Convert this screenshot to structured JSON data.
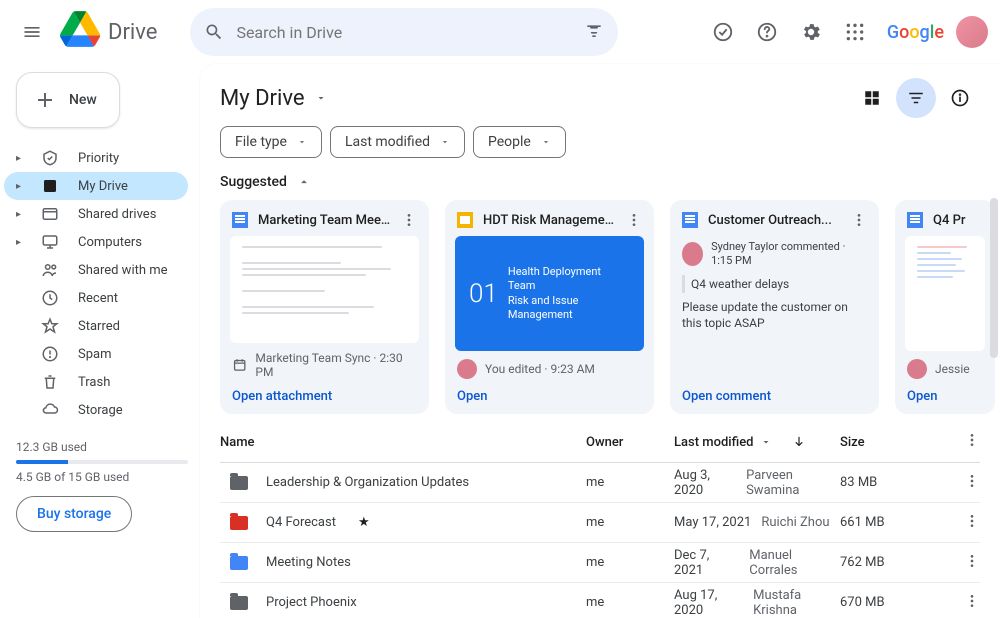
{
  "header": {
    "product": "Drive",
    "search_placeholder": "Search in Drive",
    "google": "Google"
  },
  "sidebar": {
    "new": "New",
    "items": [
      {
        "label": "Priority"
      },
      {
        "label": "My Drive"
      },
      {
        "label": "Shared drives"
      },
      {
        "label": "Computers"
      },
      {
        "label": "Shared with me"
      },
      {
        "label": "Recent"
      },
      {
        "label": "Starred"
      },
      {
        "label": "Spam"
      },
      {
        "label": "Trash"
      },
      {
        "label": "Storage"
      }
    ],
    "storage_used": "12.3 GB used",
    "storage_quota": "4.5 GB of 15 GB used",
    "buy": "Buy storage"
  },
  "main": {
    "title": "My Drive",
    "filters": [
      {
        "label": "File type"
      },
      {
        "label": "Last modified"
      },
      {
        "label": "People"
      }
    ],
    "suggested": "Suggested"
  },
  "cards": [
    {
      "title": "Marketing Team Meetin...",
      "footer_text": "Marketing Team Sync · 2:30 PM",
      "action": "Open attachment"
    },
    {
      "title": "HDT Risk Management",
      "footer_text": "You edited · 9:23 AM",
      "action": "Open",
      "slide_num": "01",
      "slide_top": "Health Deployment Team",
      "slide_bot": "Risk and Issue Management"
    },
    {
      "title": "Customer Outreach...",
      "who": "Sydney Taylor commented · 1:15 PM",
      "subject": "Q4 weather delays",
      "body": "Please update the customer on this topic ASAP",
      "action": "Open comment"
    },
    {
      "title": "Q4 Pr",
      "footer_text": "Jessie",
      "action": "Open"
    }
  ],
  "table": {
    "headers": {
      "name": "Name",
      "owner": "Owner",
      "modified": "Last modified",
      "size": "Size"
    },
    "rows": [
      {
        "name": "Leadership & Organization Updates",
        "owner": "me",
        "date": "Aug 3, 2020",
        "user": "Parveen Swamina",
        "size": "83 MB",
        "color": "gray",
        "starred": false
      },
      {
        "name": "Q4 Forecast",
        "owner": "me",
        "date": "May 17, 2021",
        "user": "Ruichi Zhou",
        "size": "661 MB",
        "color": "red",
        "starred": true
      },
      {
        "name": "Meeting Notes",
        "owner": "me",
        "date": "Dec 7, 2021",
        "user": "Manuel Corrales",
        "size": "762 MB",
        "color": "blue",
        "starred": false
      },
      {
        "name": "Project Phoenix",
        "owner": "me",
        "date": "Aug 17, 2020",
        "user": "Mustafa Krishna",
        "size": "670 MB",
        "color": "gray",
        "starred": false
      }
    ]
  }
}
